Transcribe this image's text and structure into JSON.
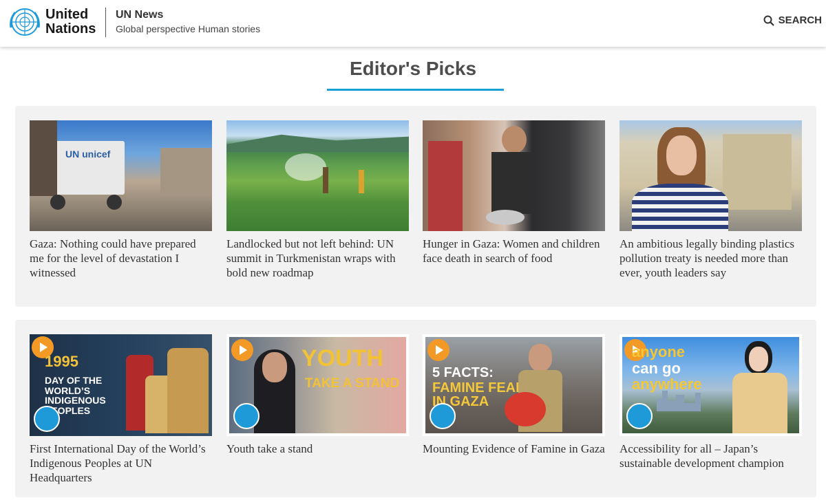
{
  "header": {
    "brand_line1": "United",
    "brand_line2": "Nations",
    "site_name": "UN News",
    "tagline": "Global perspective Human stories",
    "search_label": "SEARCH"
  },
  "section": {
    "title": "Editor's Picks"
  },
  "stories": [
    {
      "title": "Gaza: Nothing could have prepared me for the level of devastation I witnessed",
      "image_text": "UN unicef"
    },
    {
      "title": "Landlocked but not left behind: UN summit in Turkmenistan wraps with bold new roadmap"
    },
    {
      "title": "Hunger in Gaza: Women and children face death in search of food"
    },
    {
      "title": "An ambitious legally binding plastics pollution treaty is needed more than ever, youth leaders say"
    }
  ],
  "videos": [
    {
      "title": "First International Day of the World’s Indigenous Peoples at UN Headquarters",
      "overlay_year": "1995",
      "overlay_text": "DAY OF THE WORLD’S INDIGENOUS PEOPLES"
    },
    {
      "title": "Youth take a stand",
      "overlay_big": "YOUTH",
      "overlay_small": "TAKE A STAND"
    },
    {
      "title": "Mounting Evidence of Famine in Gaza",
      "overlay_line1": "5 FACTS:",
      "overlay_line2": "FAMINE FEARED",
      "overlay_line3": "IN GAZA"
    },
    {
      "title": "Accessibility for all – Japan’s sustainable development champion",
      "overlay_line1": "anyone",
      "overlay_line2": "can go",
      "overlay_line3": "anywhere"
    }
  ],
  "colors": {
    "accent": "#1c9fd6",
    "play": "#f39a26",
    "un_blue": "#1f9ad8",
    "row_bg": "#f2f2f2"
  }
}
